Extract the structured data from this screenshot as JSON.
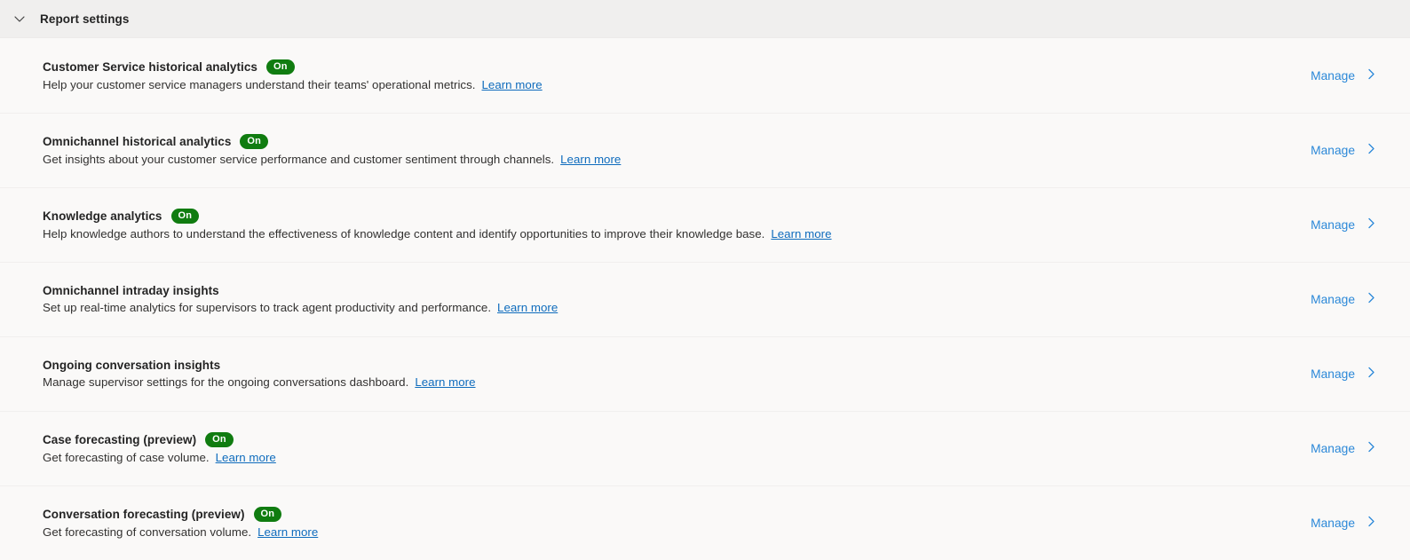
{
  "header": {
    "title": "Report settings",
    "collapse_icon": "chevron-down-icon"
  },
  "common": {
    "manage_label": "Manage",
    "learn_more_label": "Learn more",
    "chevron_icon": "chevron-right-icon",
    "accent_link_color": "#2b88d8",
    "learn_more_color": "#0f6cbd",
    "badge_on_color": "#107c10",
    "header_band_color": "#f0efee",
    "page_background": "#faf9f8"
  },
  "settings": [
    {
      "title": "Customer Service historical analytics",
      "badge": "On",
      "description": "Help your customer service managers understand their teams' operational metrics.",
      "learn_more": "Learn more",
      "action": "Manage"
    },
    {
      "title": "Omnichannel historical analytics",
      "badge": "On",
      "description": "Get insights about your customer service performance and customer sentiment through channels.",
      "learn_more": "Learn more",
      "action": "Manage"
    },
    {
      "title": "Knowledge analytics",
      "badge": "On",
      "description": "Help knowledge authors to understand the effectiveness of knowledge content and identify opportunities to improve their knowledge base.",
      "learn_more": "Learn more",
      "action": "Manage"
    },
    {
      "title": "Omnichannel intraday insights",
      "badge": null,
      "description": "Set up real-time analytics for supervisors to track agent productivity and performance.",
      "learn_more": "Learn more",
      "action": "Manage"
    },
    {
      "title": "Ongoing conversation insights",
      "badge": null,
      "description": "Manage supervisor settings for the ongoing conversations dashboard.",
      "learn_more": "Learn more",
      "action": "Manage"
    },
    {
      "title": "Case forecasting (preview)",
      "badge": "On",
      "description": "Get forecasting of case volume.",
      "learn_more": "Learn more",
      "action": "Manage"
    },
    {
      "title": "Conversation forecasting (preview)",
      "badge": "On",
      "description": "Get forecasting of conversation volume.",
      "learn_more": "Learn more",
      "action": "Manage"
    }
  ]
}
